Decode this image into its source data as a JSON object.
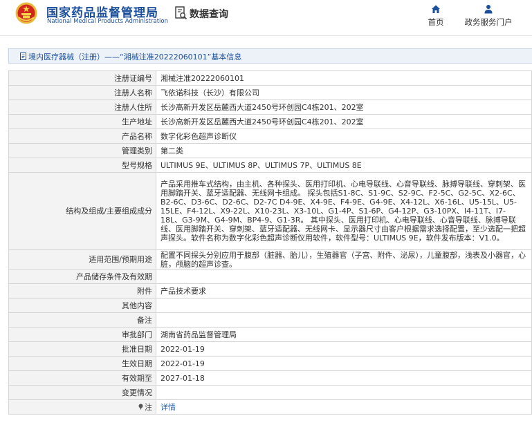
{
  "header": {
    "brand_cn": "国家药品监督管理局",
    "brand_en": "National Medical Products Administration",
    "query_label": "数据查询",
    "nav": [
      {
        "label": "首页",
        "icon": "home-icon"
      },
      {
        "label": "政务服务门户",
        "icon": "user-icon"
      }
    ]
  },
  "breadcrumb": {
    "text": "境内医疗器械（注册）——“湘械注准20222060101”基本信息"
  },
  "colors": {
    "brand_blue": "#1c4f9c",
    "link_blue": "#2a64b2",
    "label_bg": "#f3f3f3",
    "crumb_bg": "#edf2f9"
  },
  "details": [
    {
      "label": "注册证编号",
      "value": "湘械注准20222060101"
    },
    {
      "label": "注册人名称",
      "value": "飞依诺科技（长沙）有限公司"
    },
    {
      "label": "注册人住所",
      "value": "长沙高新开发区岳麓西大道2450号环创园C4栋201、202室"
    },
    {
      "label": "生产地址",
      "value": "长沙高新开发区岳麓西大道2450号环创园C4栋201、202室"
    },
    {
      "label": "产品名称",
      "value": "数字化彩色超声诊断仪"
    },
    {
      "label": "管理类别",
      "value": "第二类"
    },
    {
      "label": "型号规格",
      "value": "ULTIMUS 9E、ULTIMUS 8P、ULTIMUS 7P、ULTIMUS 8E"
    },
    {
      "label": "结构及组成/主要组成成分",
      "value": "产品采用推车式结构，由主机、各种探头、医用打印机、心电导联线、心音导联线、脉搏导联线、穿刺架、医用脚踏开关、蓝牙适配器、无线网卡组成。 探头包括S1-8C、S1-9C、S2-9C、F2-5C、G2-5C、X2-6C、B2-6C、D3-6C、D2-6C、D2-7C D4-9E、X4-9E、F4-9E、G4-9E、X4-12L、X6-16L、U5-15L、U5-15LE、F4-12L、X9-22L、X10-23L、X3-10L、G1-4P、S1-6P、G4-12P、G3-10PX、I4-11T、I7-18L、G3-9M、G4-9M、BP4-9、G1-3R。 其中探头、医用打印机、心电导联线、心音导联线、脉搏导联线、医用脚踏开关、穿刺架、蓝牙适配器、无线网卡、显示器尺寸由客户根据需求选择配置，至少选配一把超声探头。软件名称为数字化彩色超声诊断仪用软件，软件型号：ULTIMUS 9E，软件发布版本：V1.0。"
    },
    {
      "label": "适用范围/预期用途",
      "value": "配置不同探头分别应用于腹部（脏器、胎儿），生殖器官（子宫、附件、泌尿），儿童腹部，浅表及小器官，心脏，颅脑的超声诊查。"
    },
    {
      "label": "产品储存条件及有效期",
      "value": ""
    },
    {
      "label": "附件",
      "value": "产品技术要求"
    },
    {
      "label": "其他内容",
      "value": ""
    },
    {
      "label": "备注",
      "value": ""
    },
    {
      "label": "审批部门",
      "value": "湖南省药品监督管理局"
    },
    {
      "label": "批准日期",
      "value": "2022-01-19"
    },
    {
      "label": "生效日期",
      "value": "2022-01-19"
    },
    {
      "label": "有效期至",
      "value": "2027-01-18"
    },
    {
      "label": "变更情况",
      "value": ""
    },
    {
      "label": "注",
      "value": "详情"
    }
  ]
}
